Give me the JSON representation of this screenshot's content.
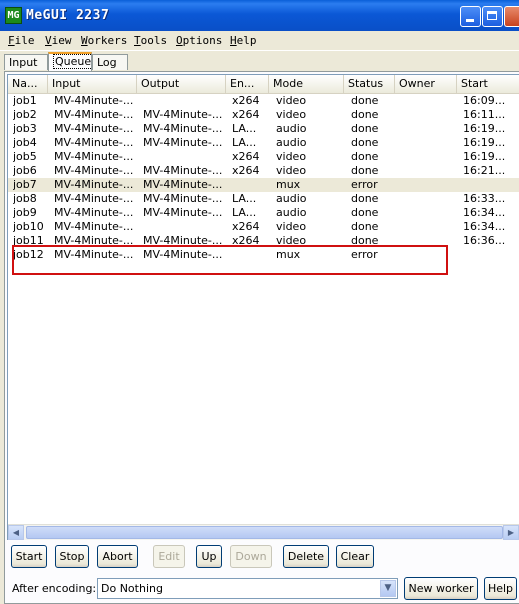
{
  "window": {
    "title": "MeGUI 2237",
    "icon_text": "MG"
  },
  "menu": [
    {
      "label": "File",
      "first": "F",
      "rest": "ile"
    },
    {
      "label": "View",
      "first": "V",
      "rest": "iew"
    },
    {
      "label": "Workers",
      "first": "W",
      "rest": "orkers"
    },
    {
      "label": "Tools",
      "first": "T",
      "rest": "ools"
    },
    {
      "label": "Options",
      "first": "O",
      "rest": "ptions"
    },
    {
      "label": "Help",
      "first": "H",
      "rest": "elp"
    }
  ],
  "tabs": [
    "Input",
    "Queue",
    "Log"
  ],
  "active_tab": "Queue",
  "columns": [
    "Na...",
    "Input",
    "Output",
    "En...",
    "Mode",
    "Status",
    "Owner",
    "Start"
  ],
  "rows": [
    [
      "job1",
      "MV-4Minute-...",
      "",
      "x264",
      "video",
      "done",
      "",
      "16:09..."
    ],
    [
      "job2",
      "MV-4Minute-...",
      "MV-4Minute-...",
      "x264",
      "video",
      "done",
      "",
      "16:11..."
    ],
    [
      "job3",
      "MV-4Minute-...",
      "MV-4Minute-...",
      "LA...",
      "audio",
      "done",
      "",
      "16:19..."
    ],
    [
      "job4",
      "MV-4Minute-...",
      "MV-4Minute-...",
      "LA...",
      "audio",
      "done",
      "",
      "16:19..."
    ],
    [
      "job5",
      "MV-4Minute-...",
      "",
      "x264",
      "video",
      "done",
      "",
      "16:19..."
    ],
    [
      "job6",
      "MV-4Minute-...",
      "MV-4Minute-...",
      "x264",
      "video",
      "done",
      "",
      "16:21..."
    ],
    [
      "job7",
      "MV-4Minute-...",
      "MV-4Minute-...",
      "",
      "mux",
      "error",
      "",
      ""
    ],
    [
      "job8",
      "MV-4Minute-...",
      "MV-4Minute-...",
      "LA...",
      "audio",
      "done",
      "",
      "16:33..."
    ],
    [
      "job9",
      "MV-4Minute-...",
      "MV-4Minute-...",
      "LA...",
      "audio",
      "done",
      "",
      "16:34..."
    ],
    [
      "job10",
      "MV-4Minute-...",
      "",
      "x264",
      "video",
      "done",
      "",
      "16:34..."
    ],
    [
      "job11",
      "MV-4Minute-...",
      "MV-4Minute-...",
      "x264",
      "video",
      "done",
      "",
      "16:36..."
    ],
    [
      "job12",
      "MV-4Minute-...",
      "MV-4Minute-...",
      "",
      "mux",
      "error",
      "",
      ""
    ]
  ],
  "highlighted_row": "job7",
  "annotated_row": "job12",
  "buttons": {
    "start": "Start",
    "stop": "Stop",
    "abort": "Abort",
    "edit": "Edit",
    "up": "Up",
    "down": "Down",
    "delete": "Delete",
    "clear": "Clear",
    "new_worker": "New worker",
    "help": "Help"
  },
  "disabled_buttons": [
    "edit",
    "down"
  ],
  "after_encoding": {
    "label": "After encoding:",
    "value": "Do Nothing"
  },
  "colors": {
    "titlebar": "#0b58d6",
    "annotation_box": "#d01010",
    "highlight_row": "#ece9d8"
  }
}
